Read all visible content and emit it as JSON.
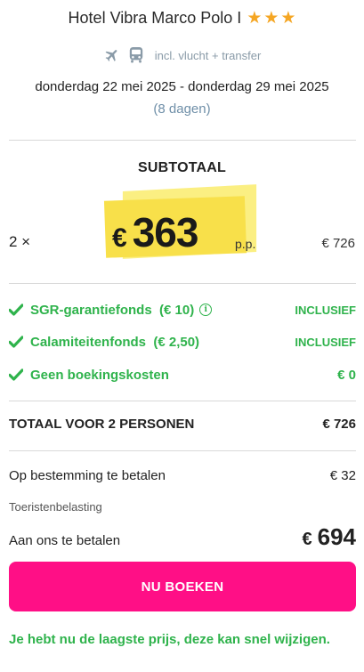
{
  "hotel": {
    "name": "Hotel Vibra Marco Polo I",
    "stars": [
      "★",
      "★",
      "★"
    ]
  },
  "transport": {
    "icons": [
      "plane-icon",
      "bus-icon"
    ],
    "label": "incl. vlucht + transfer"
  },
  "trip": {
    "dates": "donderdag 22 mei 2025 - donderdag 29 mei 2025",
    "duration": "(8 dagen)"
  },
  "subtotal": {
    "title": "SUBTOTAAL",
    "quantity": "2 ×",
    "currency": "€",
    "price_per_person": "363",
    "per_person_label": "p.p.",
    "line_total": "€ 726",
    "highlight_color": "#f8e04a"
  },
  "fees": [
    {
      "label": "SGR-garantiefonds  (€ 10)",
      "status": "INCLUSIEF",
      "info": "i"
    },
    {
      "label": "Calamiteitenfonds  (€ 2,50)",
      "status": "INCLUSIEF"
    },
    {
      "label": "Geen boekingskosten",
      "status": "€ 0"
    }
  ],
  "total": {
    "label": "TOTAAL VOOR 2 PERSONEN",
    "amount": "€ 726"
  },
  "destination": {
    "label": "Op bestemming te betalen",
    "amount": "€ 32",
    "note": "Toeristenbelasting"
  },
  "pay": {
    "label": "Aan ons te betalen",
    "currency": "€",
    "amount": "694"
  },
  "cta": {
    "label": "NU BOEKEN",
    "color": "#ff0f86"
  },
  "notice": "Je hebt nu de laagste prijs, deze kan snel wijzigen.",
  "colors": {
    "accent_green": "#2fb34c",
    "star": "#f5a623",
    "muted_blue": "#6f8fa8"
  }
}
